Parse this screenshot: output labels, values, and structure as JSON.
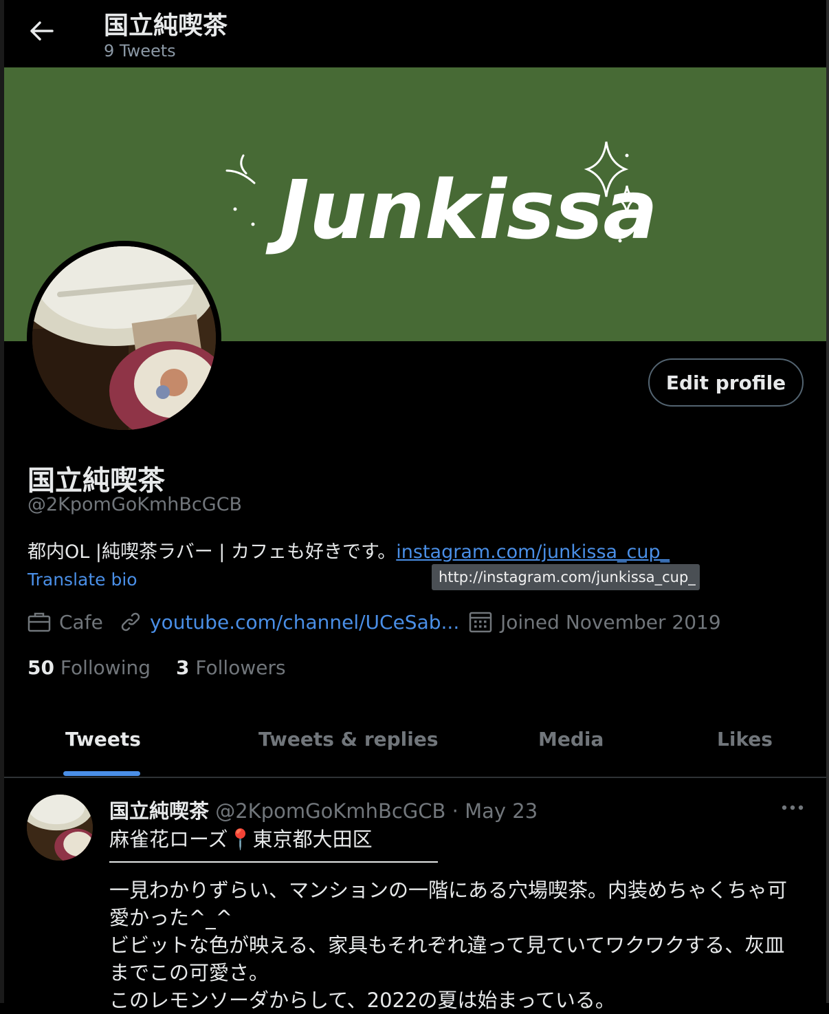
{
  "header": {
    "title": "国立純喫茶",
    "tweet_count": "9 Tweets"
  },
  "banner": {
    "text": "Junkissa",
    "bg_color": "#476a35"
  },
  "profile": {
    "edit_label": "Edit profile",
    "name": "国立純喫茶",
    "handle": "@2KpomGoKmhBcGCB",
    "bio_text": "都内OL |純喫茶ラバー | カフェも好きです。",
    "bio_link": "instagram.com/junkissa_cup_",
    "tooltip": "http://instagram.com/junkissa_cup_",
    "translate_label": "Translate bio",
    "category": "Cafe",
    "website": "youtube.com/channel/UCeSab...",
    "joined": "Joined November 2019",
    "following_count": "50",
    "following_label": "Following",
    "followers_count": "3",
    "followers_label": "Followers"
  },
  "tabs": [
    {
      "label": "Tweets",
      "active": true
    },
    {
      "label": "Tweets & replies",
      "active": false
    },
    {
      "label": "Media",
      "active": false
    },
    {
      "label": "Likes",
      "active": false
    }
  ],
  "tweet": {
    "author": "国立純喫茶",
    "handle_date": "@2KpomGoKmhBcGCB · May 23",
    "line1": "麻雀花ローズ📍東京都大田区",
    "line2": "一見わかりずらい、マンションの一階にある穴場喫茶。内装めちゃくちゃ可愛かった^_^",
    "line3": "ビビットな色が映える、家具もそれぞれ違って見ていてワクワクする、灰皿までこの可愛さ。",
    "line4": "このレモンソーダからして、2022の夏は始まっている。"
  },
  "colors": {
    "accent": "#4a8fe7",
    "muted": "#71767b",
    "text": "#e7e9ea",
    "background": "#000000"
  }
}
